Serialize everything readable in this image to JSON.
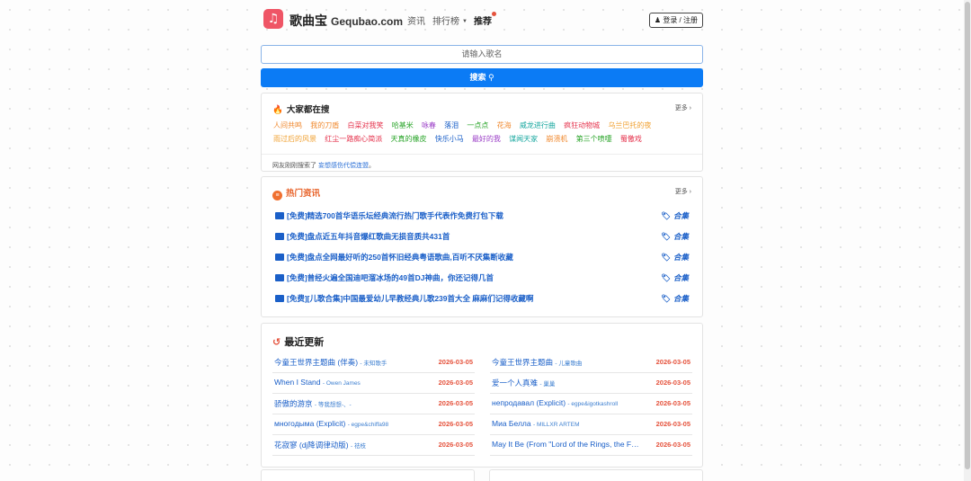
{
  "nav": {
    "logo_glyph": "♫",
    "brand": "歌曲宝",
    "domain": "Gequbao.com",
    "links": [
      "资讯",
      "排行榜",
      "推荐"
    ],
    "login_label": "登录 / 注册"
  },
  "search": {
    "placeholder": "请输入歌名",
    "button_label": "搜索"
  },
  "hot": {
    "title": "大家都在搜",
    "more": "更多",
    "tags": [
      {
        "text": "人间共鸣",
        "color": "#f08a30"
      },
      {
        "text": "我的刀盾",
        "color": "#f08a30"
      },
      {
        "text": "白菜对我笑",
        "color": "#e5334d"
      },
      {
        "text": "哈基米",
        "color": "#2aa52a"
      },
      {
        "text": "咏春",
        "color": "#9b3fc7"
      },
      {
        "text": "落泪",
        "color": "#1a5fc8"
      },
      {
        "text": "一点点",
        "color": "#2aa52a"
      },
      {
        "text": "花海",
        "color": "#f08a30"
      },
      {
        "text": "威龙进行曲",
        "color": "#1aa8a0"
      },
      {
        "text": "疯狂动物城",
        "color": "#e5334d"
      },
      {
        "text": "乌兰巴托的夜",
        "color": "#f0a030"
      },
      {
        "text": "雨过后的风景",
        "color": "#f0a030"
      },
      {
        "text": "红尘一路痴心简派",
        "color": "#e5334d"
      },
      {
        "text": "天真的橡皮",
        "color": "#2aa52a"
      },
      {
        "text": "快乐小马",
        "color": "#1a5fc8"
      },
      {
        "text": "最好的我",
        "color": "#9b3fc7"
      },
      {
        "text": "谋闻天家",
        "color": "#1aa8a0"
      },
      {
        "text": "崩溃机",
        "color": "#f08a30"
      },
      {
        "text": "第三个喷嚏",
        "color": "#2aa52a"
      },
      {
        "text": "蜀儌戏",
        "color": "#e5334d"
      }
    ],
    "footer_prefix": "网友刚刚搜索了",
    "footer_link": "妄想感伤代偿连盟"
  },
  "news": {
    "title": "热门资讯",
    "more": "更多",
    "items": [
      {
        "title": "[免费]精选700首华语乐坛经典流行热门歌手代表作免费打包下载",
        "badge": "合集"
      },
      {
        "title": "[免费]盘点近五年抖音爆红歌曲无损音质共431首",
        "badge": "合集"
      },
      {
        "title": "[免费]盘点全网最好听的250首怀旧经典粤语歌曲,百听不厌集断收藏",
        "badge": "合集"
      },
      {
        "title": "[免费]曾经火遍全国迪吧溜冰场的49首DJ神曲，你还记得几首",
        "badge": "合集"
      },
      {
        "title": "[免费][儿歌合集]中国最爱幼儿早教经典儿歌239首大全 麻麻们记得收藏啊",
        "badge": "合集"
      }
    ]
  },
  "recent": {
    "title": "最近更新",
    "left": [
      {
        "song": "今童王世界主题曲 (伴奏)",
        "artist": "未知歌手",
        "date": "2026-03-05"
      },
      {
        "song": "When I Stand",
        "artist": "Owen James",
        "date": "2026-03-05"
      },
      {
        "song": "骄傲的游京",
        "artist": "等我想想-、-",
        "date": "2026-03-05"
      },
      {
        "song": "многодыма (Explicit)",
        "artist": "egpe&chiffa98",
        "date": "2026-03-05"
      },
      {
        "song": "花寂寥 (dj降调律动版)",
        "artist": "祛枝",
        "date": "2026-03-05"
      }
    ],
    "right": [
      {
        "song": "今童王世界主题曲",
        "artist": "儿童歌曲",
        "date": "2026-03-05"
      },
      {
        "song": "爱一个人真难",
        "artist": "巢巢",
        "date": "2026-03-05"
      },
      {
        "song": "непродавал (Explicit)",
        "artist": "egpe&igotkashroll",
        "date": "2026-03-05"
      },
      {
        "song": "Миа Белла",
        "artist": "MILLXR ARTEM",
        "date": "2026-03-05"
      },
      {
        "song": "May It Be (From \"Lord of the Rings, the F…",
        "artist": "",
        "date": "2026-03-05"
      }
    ]
  }
}
